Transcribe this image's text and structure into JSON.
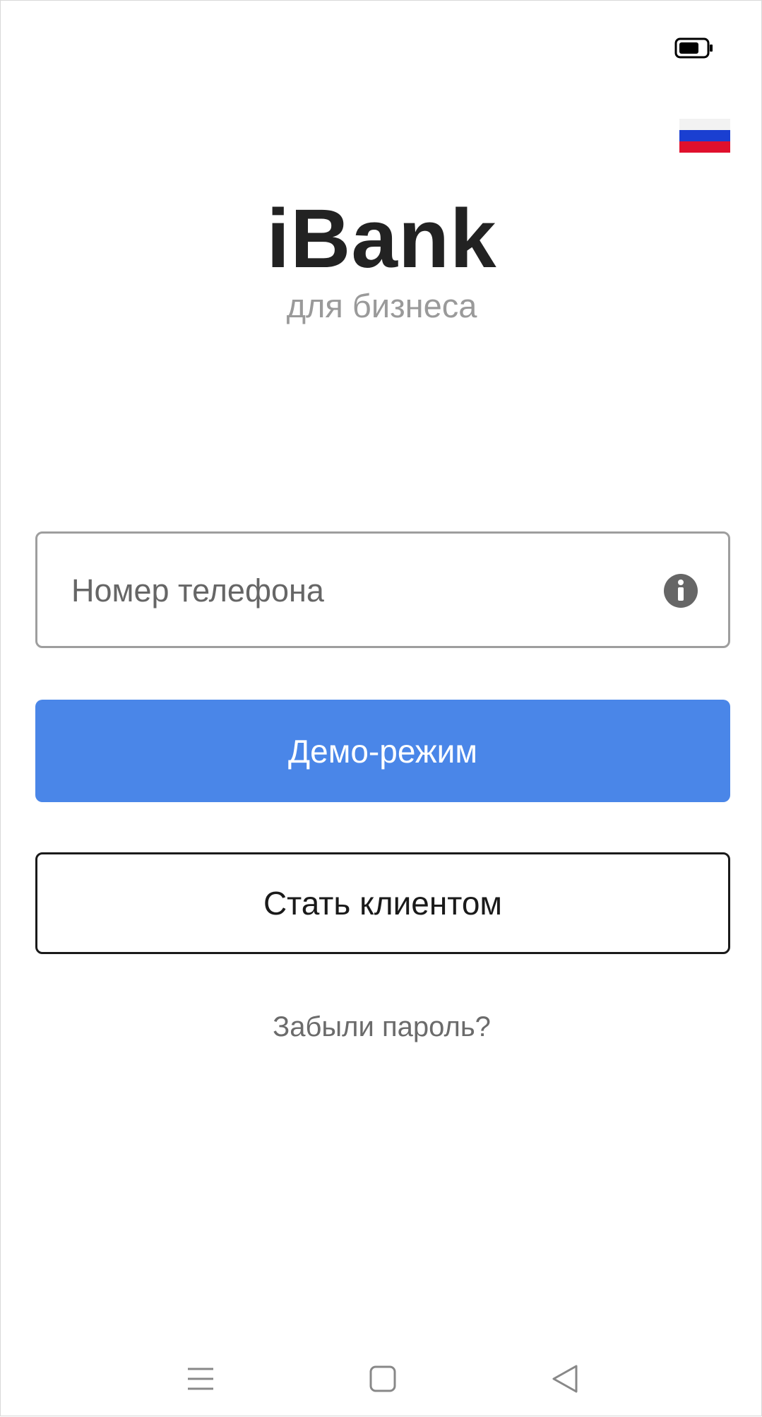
{
  "status_bar": {
    "battery_icon": "battery-icon"
  },
  "language": {
    "icon": "russian-flag-icon",
    "colors": [
      "#f2f2f2",
      "#1a3fd1",
      "#e0102d"
    ]
  },
  "logo": {
    "title": "iBank",
    "subtitle": "для бизнеса"
  },
  "login": {
    "phone_placeholder": "Номер телефона",
    "phone_value": "",
    "info_icon": "info-icon"
  },
  "buttons": {
    "demo_label": "Демо-режим",
    "become_client_label": "Стать клиентом"
  },
  "links": {
    "forgot_password": "Забыли пароль?"
  },
  "nav_bar": {
    "items": [
      "menu-icon",
      "home-icon",
      "back-icon"
    ]
  },
  "colors": {
    "accent": "#4a86e8",
    "title": "#222222",
    "subtitle": "#9a9a9a"
  }
}
